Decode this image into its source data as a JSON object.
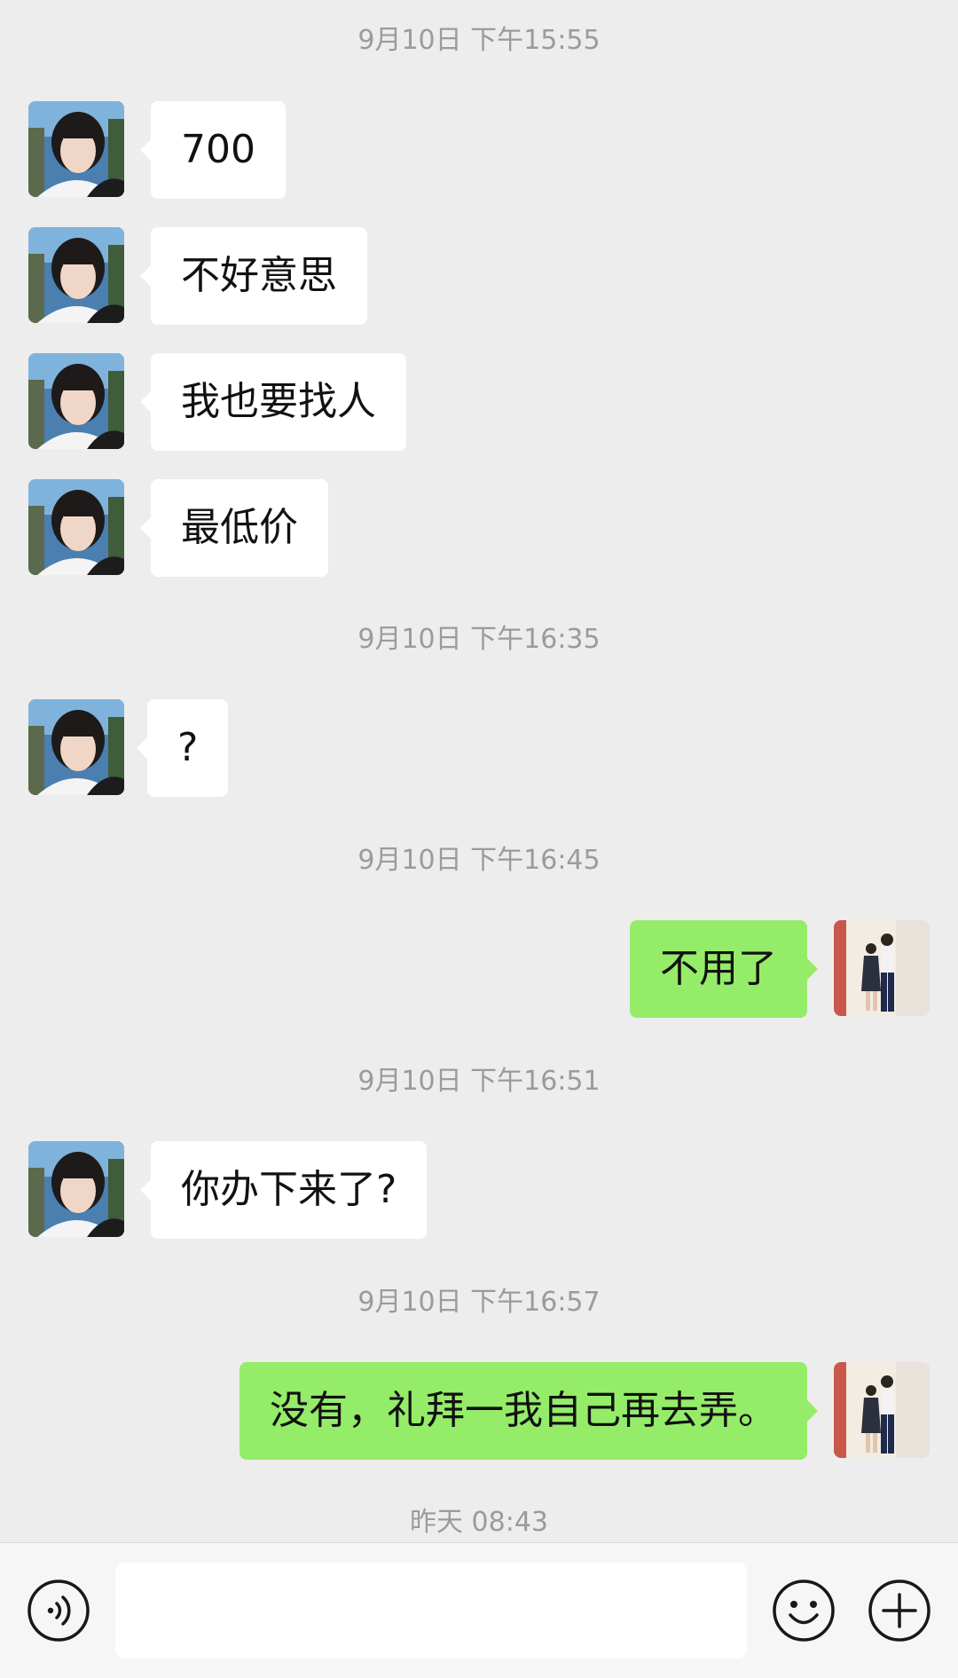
{
  "messages": [
    {
      "type": "time",
      "text": "9月10日 下午15:55"
    },
    {
      "type": "in",
      "text": "700"
    },
    {
      "type": "in",
      "text": "不好意思"
    },
    {
      "type": "in",
      "text": "我也要找人"
    },
    {
      "type": "in",
      "text": "最低价"
    },
    {
      "type": "time",
      "text": "9月10日 下午16:35"
    },
    {
      "type": "in",
      "text": "?"
    },
    {
      "type": "time",
      "text": "9月10日 下午16:45"
    },
    {
      "type": "out",
      "text": "不用了"
    },
    {
      "type": "time",
      "text": "9月10日 下午16:51"
    },
    {
      "type": "in",
      "text": "你办下来了?"
    },
    {
      "type": "time",
      "text": "9月10日 下午16:57"
    },
    {
      "type": "out",
      "text": "没有，礼拜一我自己再去弄。"
    },
    {
      "type": "time",
      "text": "昨天 08:43"
    }
  ],
  "input_bar": {
    "voice_icon": "voice-icon",
    "message_value": "",
    "emoji_icon": "emoji-icon",
    "plus_icon": "plus-icon"
  },
  "colors": {
    "background": "#ededed",
    "incoming_bubble": "#ffffff",
    "outgoing_bubble": "#95ec69",
    "timestamp_text": "#9b9b9b"
  }
}
